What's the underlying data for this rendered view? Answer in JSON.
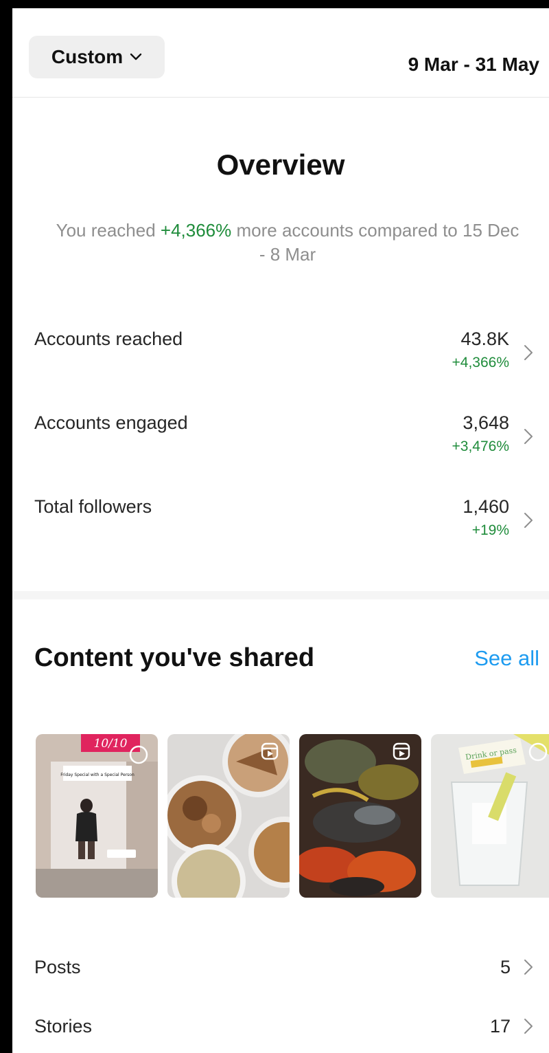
{
  "header": {
    "filter_label": "Custom",
    "date_range": "9 Mar - 31 May"
  },
  "overview": {
    "title": "Overview",
    "summary_prefix": "You reached ",
    "summary_pct": "+4,366%",
    "summary_suffix": " more accounts compared to 15 Dec - 8 Mar",
    "metrics": [
      {
        "label": "Accounts reached",
        "value": "43.8K",
        "change": "+4,366%"
      },
      {
        "label": "Accounts engaged",
        "value": "3,648",
        "change": "+3,476%"
      },
      {
        "label": "Total followers",
        "value": "1,460",
        "change": "+19%"
      }
    ]
  },
  "content": {
    "title": "Content you've shared",
    "see_all": "See all",
    "thumbnails": [
      {
        "kind": "story",
        "badge": "10/10",
        "caption": "Friday Special with a Special Person"
      },
      {
        "kind": "reel",
        "icon": "reel-icon"
      },
      {
        "kind": "reel",
        "icon": "reel-icon"
      },
      {
        "kind": "story",
        "caption": "Drink or pass"
      }
    ],
    "rows": [
      {
        "label": "Posts",
        "value": "5"
      },
      {
        "label": "Stories",
        "value": "17"
      }
    ]
  },
  "colors": {
    "positive": "#1f8c3b",
    "link": "#1d9bf0",
    "muted_text": "#8e8e8e"
  }
}
